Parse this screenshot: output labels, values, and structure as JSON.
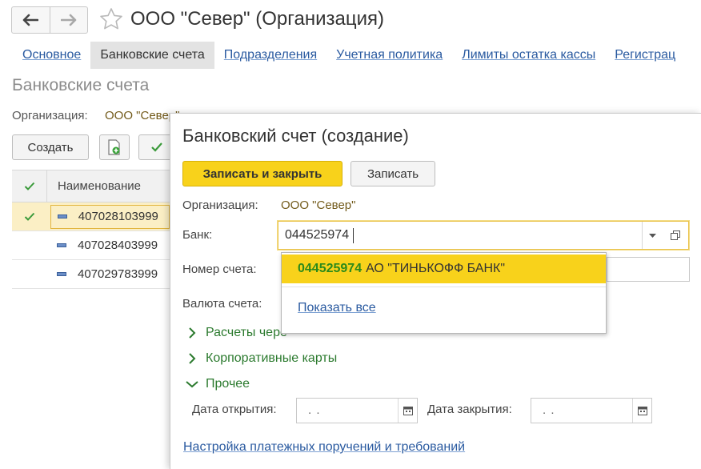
{
  "window": {
    "title": "ООО \"Север\" (Организация)"
  },
  "tabs": [
    {
      "label": "Основное"
    },
    {
      "label": "Банковские счета"
    },
    {
      "label": "Подразделения"
    },
    {
      "label": "Учетная политика"
    },
    {
      "label": "Лимиты остатка кассы"
    },
    {
      "label": "Регистрац"
    }
  ],
  "background_form": {
    "title": "Банковские счета",
    "organization_label": "Организация:",
    "organization_value": "ООО \"Север\"",
    "create_button": "Создать",
    "column_name": "Наименование",
    "rows": [
      {
        "name": "407028103999"
      },
      {
        "name": "407028403999"
      },
      {
        "name": "407029783999"
      }
    ]
  },
  "dialog": {
    "title": "Банковский счет (создание)",
    "save_close_button": "Записать и закрыть",
    "save_button": "Записать",
    "organization_label": "Организация:",
    "organization_value": "ООО \"Север\"",
    "bank_label": "Банк:",
    "bank_value": "044525974",
    "account_label": "Номер счета:",
    "currency_label": "Валюта счета:",
    "dropdown": {
      "item_code": "044525974",
      "item_name": "АО \"ТИНЬКОФФ БАНК\"",
      "show_all": "Показать все"
    },
    "sections": {
      "payments_partial": "Расчеты чере",
      "corporate_cards": "Корпоративные карты",
      "other": "Прочее"
    },
    "open_date_label": "Дата открытия:",
    "open_date_value": ". .",
    "close_date_label": "Дата закрытия:",
    "close_date_value": ". .",
    "settings_link": "Настройка платежных поручений и требований"
  },
  "colors": {
    "accent_yellow": "#f8d21b",
    "link_blue": "#2a5aa0",
    "section_green": "#2b7a2e",
    "org_value_brown": "#725a1a"
  }
}
